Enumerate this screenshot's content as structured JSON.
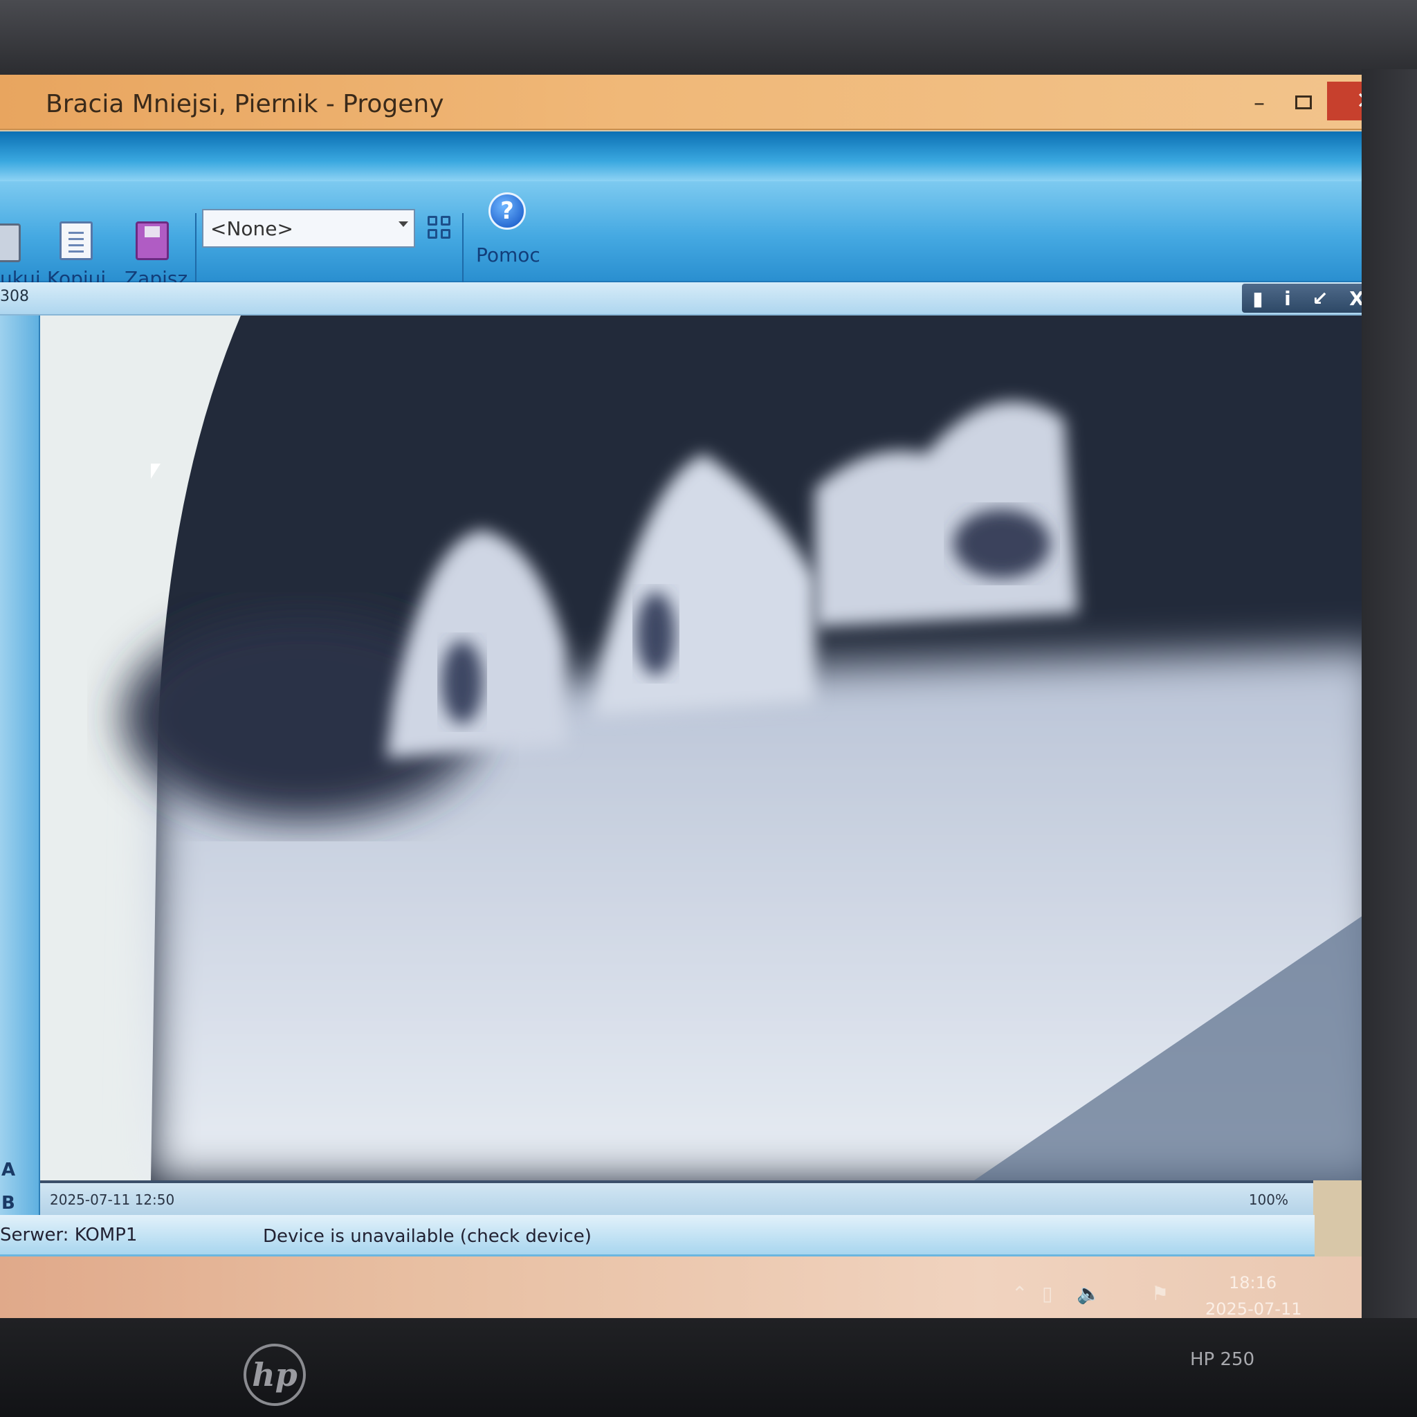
{
  "window": {
    "title": "Bracia Mniejsi, Piernik - Progeny",
    "minimize_glyph": "–",
    "close_glyph": "✕"
  },
  "toolbar": {
    "print_label": "ukuj",
    "copy_label": "Kopiuj",
    "save_label": "Zapisz",
    "filter_value": "<None>",
    "help_label": "Pomoc",
    "help_glyph": "?"
  },
  "image_panel": {
    "id_fragment": "308",
    "tool_glyphs": [
      "▮",
      "i",
      "↙",
      "X"
    ],
    "left_labels": [
      "A",
      "B"
    ],
    "capture_datetime": "2025-07-11 12:50",
    "zoom": "100%"
  },
  "statusbar": {
    "server": "Serwer:  KOMP1",
    "device_status": "Device is unavailable (check device)"
  },
  "taskbar": {
    "time": "18:16",
    "date": "2025-07-11"
  },
  "device": {
    "model": "HP 250",
    "logo": "hp"
  },
  "colors": {
    "titlebar": "#e8a55f",
    "toolbar": "#45a9e2",
    "close_button": "#c7402d"
  }
}
